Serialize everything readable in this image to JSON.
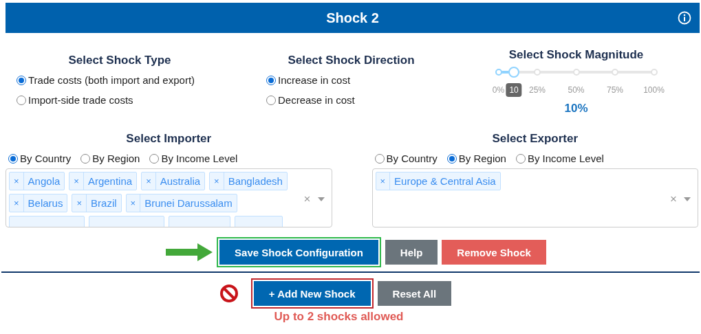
{
  "header": {
    "title": "Shock 2"
  },
  "shock_type": {
    "heading": "Select Shock Type",
    "options": [
      {
        "label": "Trade costs (both import and export)",
        "selected": true
      },
      {
        "label": "Import-side trade costs",
        "selected": false
      }
    ]
  },
  "shock_direction": {
    "heading": "Select Shock Direction",
    "options": [
      {
        "label": "Increase in cost",
        "selected": true
      },
      {
        "label": "Decrease in cost",
        "selected": false
      }
    ]
  },
  "magnitude": {
    "heading": "Select Shock Magnitude",
    "level": 0.1,
    "thumb_label": "10",
    "ticks": [
      "0%",
      "25%",
      "50%",
      "75%",
      "100%"
    ],
    "value": "10%"
  },
  "importer": {
    "heading": "Select Importer",
    "modes": [
      {
        "label": "By Country",
        "selected": true
      },
      {
        "label": "By Region",
        "selected": false
      },
      {
        "label": "By Income Level",
        "selected": false
      }
    ],
    "remove_mark": "×",
    "selected": [
      "Angola",
      "Argentina",
      "Australia",
      "Bangladesh",
      "Belarus",
      "Brazil",
      "Brunei Darussalam"
    ],
    "clear": "×"
  },
  "exporter": {
    "heading": "Select Exporter",
    "modes": [
      {
        "label": "By Country",
        "selected": false
      },
      {
        "label": "By Region",
        "selected": true
      },
      {
        "label": "By Income Level",
        "selected": false
      }
    ],
    "remove_mark": "×",
    "selected": [
      "Europe & Central Asia"
    ],
    "clear": "×"
  },
  "actions": [
    {
      "label": "Save Shock Configuration",
      "highlighted": true
    },
    {
      "label": "Help",
      "highlighted": false
    },
    {
      "label": "Remove Shock",
      "highlighted": false
    }
  ],
  "bottom_actions": [
    {
      "label": "+ Add New Shock",
      "highlighted": true
    },
    {
      "label": "Reset All",
      "highlighted": false
    }
  ],
  "limit_message": "Up to 2 shocks allowed"
}
